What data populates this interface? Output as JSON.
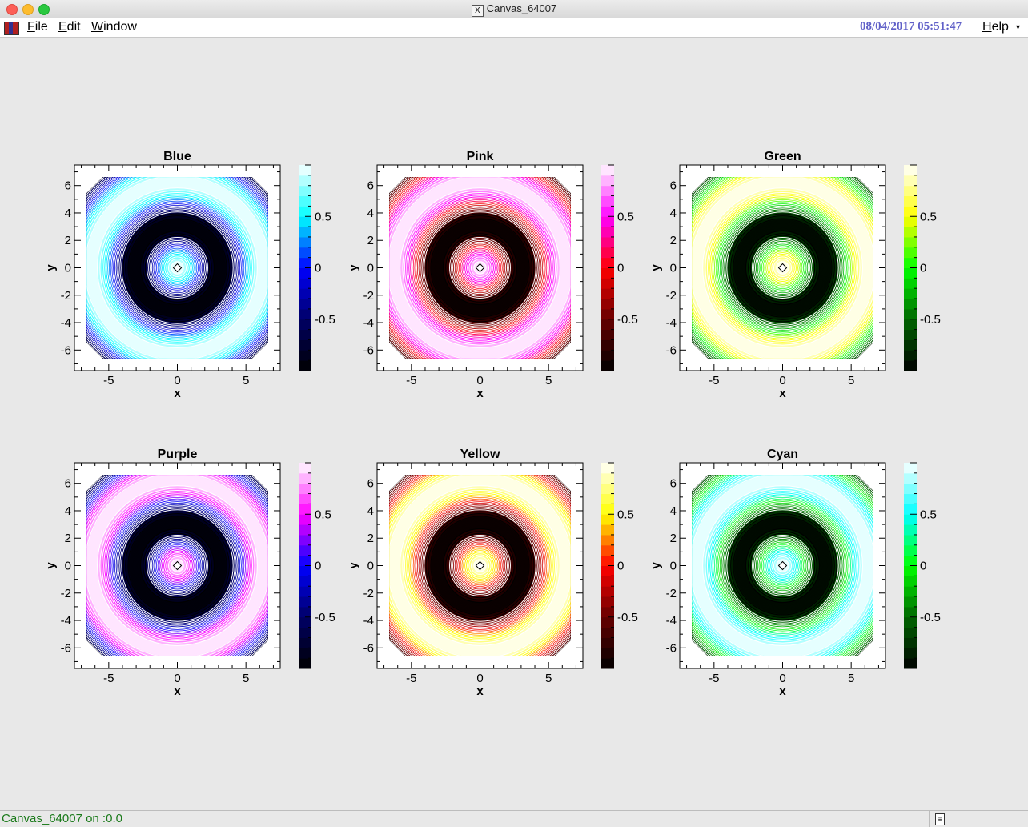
{
  "window": {
    "title": "Canvas_64007",
    "title_icon": "X"
  },
  "menubar": {
    "items": [
      {
        "label": "File",
        "underline": "F",
        "rest": "ile"
      },
      {
        "label": "Edit",
        "underline": "E",
        "rest": "dit"
      },
      {
        "label": "Window",
        "underline": "W",
        "rest": "indow"
      }
    ],
    "datetime": "08/04/2017 05:51:47",
    "help": {
      "underline": "H",
      "rest": "elp"
    },
    "help_arrow": "▾"
  },
  "status": {
    "text": "Canvas_64007 on :0.0"
  },
  "chart_data": [
    {
      "type": "heatmap",
      "title": "Blue",
      "palette": [
        "#000000",
        "#000066",
        "#0000ff",
        "#00ffff",
        "#ffffff"
      ],
      "xlabel": "x",
      "ylabel": "y",
      "xlim": [
        -7.5,
        7.5
      ],
      "ylim": [
        -7.5,
        7.5
      ],
      "xticks": [
        -5,
        0,
        5
      ],
      "yticks": [
        6,
        4,
        2,
        0,
        -2,
        -4,
        -6
      ],
      "zlim": [
        -1,
        1
      ],
      "zticks": [
        0.5,
        0,
        -0.5
      ],
      "function": "cos(sqrt(x^2+y^2))"
    },
    {
      "type": "heatmap",
      "title": "Pink",
      "palette": [
        "#000000",
        "#660000",
        "#ff0000",
        "#ff00ff",
        "#ffffff"
      ],
      "xlabel": "x",
      "ylabel": "y",
      "xlim": [
        -7.5,
        7.5
      ],
      "ylim": [
        -7.5,
        7.5
      ],
      "xticks": [
        -5,
        0,
        5
      ],
      "yticks": [
        6,
        4,
        2,
        0,
        -2,
        -4,
        -6
      ],
      "zlim": [
        -1,
        1
      ],
      "zticks": [
        0.5,
        0,
        -0.5
      ],
      "function": "cos(sqrt(x^2+y^2))"
    },
    {
      "type": "heatmap",
      "title": "Green",
      "palette": [
        "#000000",
        "#006600",
        "#00ff00",
        "#ffff00",
        "#ffffff"
      ],
      "xlabel": "x",
      "ylabel": "y",
      "xlim": [
        -7.5,
        7.5
      ],
      "ylim": [
        -7.5,
        7.5
      ],
      "xticks": [
        -5,
        0,
        5
      ],
      "yticks": [
        6,
        4,
        2,
        0,
        -2,
        -4,
        -6
      ],
      "zlim": [
        -1,
        1
      ],
      "zticks": [
        0.5,
        0,
        -0.5
      ],
      "function": "cos(sqrt(x^2+y^2))"
    },
    {
      "type": "heatmap",
      "title": "Purple",
      "palette": [
        "#000000",
        "#000066",
        "#0000ff",
        "#ff00ff",
        "#ffffff"
      ],
      "xlabel": "x",
      "ylabel": "y",
      "xlim": [
        -7.5,
        7.5
      ],
      "ylim": [
        -7.5,
        7.5
      ],
      "xticks": [
        -5,
        0,
        5
      ],
      "yticks": [
        6,
        4,
        2,
        0,
        -2,
        -4,
        -6
      ],
      "zlim": [
        -1,
        1
      ],
      "zticks": [
        0.5,
        0,
        -0.5
      ],
      "function": "cos(sqrt(x^2+y^2))"
    },
    {
      "type": "heatmap",
      "title": "Yellow",
      "palette": [
        "#000000",
        "#660000",
        "#ff0000",
        "#ffff00",
        "#ffffff"
      ],
      "xlabel": "x",
      "ylabel": "y",
      "xlim": [
        -7.5,
        7.5
      ],
      "ylim": [
        -7.5,
        7.5
      ],
      "xticks": [
        -5,
        0,
        5
      ],
      "yticks": [
        6,
        4,
        2,
        0,
        -2,
        -4,
        -6
      ],
      "zlim": [
        -1,
        1
      ],
      "zticks": [
        0.5,
        0,
        -0.5
      ],
      "function": "cos(sqrt(x^2+y^2))"
    },
    {
      "type": "heatmap",
      "title": "Cyan",
      "palette": [
        "#000000",
        "#006600",
        "#00ff00",
        "#00ffff",
        "#ffffff"
      ],
      "xlabel": "x",
      "ylabel": "y",
      "xlim": [
        -7.5,
        7.5
      ],
      "ylim": [
        -7.5,
        7.5
      ],
      "xticks": [
        -5,
        0,
        5
      ],
      "yticks": [
        6,
        4,
        2,
        0,
        -2,
        -4,
        -6
      ],
      "zlim": [
        -1,
        1
      ],
      "zticks": [
        0.5,
        0,
        -0.5
      ],
      "function": "cos(sqrt(x^2+y^2))"
    }
  ]
}
